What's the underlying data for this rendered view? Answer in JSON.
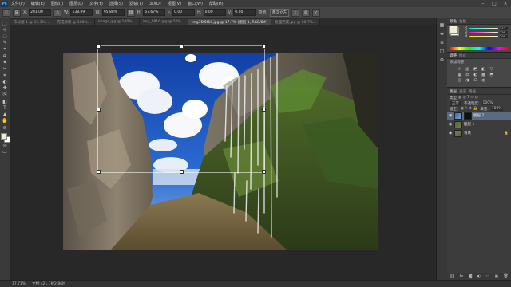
{
  "app": {
    "logo": "Ps",
    "menu": [
      "文件(F)",
      "编辑(E)",
      "图像(I)",
      "图层(L)",
      "文字(Y)",
      "选择(S)",
      "滤镜(T)",
      "3D(D)",
      "视图(V)",
      "窗口(W)",
      "帮助(H)"
    ],
    "window_controls": [
      "–",
      "□",
      "×"
    ]
  },
  "options": {
    "x_label": "X:",
    "x_value": "281.00",
    "w_label": "W:",
    "w_value": "138.09",
    "w_pct": "95.88%",
    "h_label": "H:",
    "h_value": "67.67%",
    "angle_label": "△",
    "angle_value": "0.00",
    "h_skew_label": "H:",
    "h_skew_value": "0.00",
    "v_skew_label": "V:",
    "v_skew_value": "0.00",
    "interp": "两次立方",
    "confirm": "✓",
    "cancel": "⊘"
  },
  "tabs": [
    {
      "label": "未标题-1 @ 33.3% ...",
      "active": false
    },
    {
      "label": "完成效果 @ 100%...",
      "active": false
    },
    {
      "label": "image.jpg @ 100%...",
      "active": false
    },
    {
      "label": "img_0916.jpg @ 50%...",
      "active": false
    },
    {
      "label": "img75f5f10.jpg @ 17.7% (图层 1, RGB/8#)",
      "active": true
    },
    {
      "label": "处理完成.jpg @ 66.7%...",
      "active": false
    }
  ],
  "tools": [
    "⬚",
    "⊹",
    "◌",
    "✎",
    "⌖",
    "⊕",
    "✦",
    "✂",
    "⌗",
    "◐",
    "✚",
    "⎘",
    "◧",
    "T",
    "▲",
    "✋",
    "⊚"
  ],
  "status": {
    "zoom": "17.71%",
    "doc_size": "文档:421.7K/2.86M"
  },
  "panel_strip": [
    "▦",
    "◈",
    "≡",
    "◫",
    "⚙"
  ],
  "color_panel": {
    "tabs": [
      "颜色",
      "色板"
    ],
    "fg_color": "#f2ecd1",
    "sliders": [
      {
        "letter": "R",
        "value": "242"
      },
      {
        "letter": "G",
        "value": "236"
      },
      {
        "letter": "B",
        "value": "209"
      }
    ]
  },
  "adjustments": {
    "tabs": [
      "调整",
      "样式"
    ],
    "subtitle": "添加调整",
    "icons": [
      "☼",
      "▥",
      "◩",
      "◧",
      "▽",
      "▦",
      "⚖",
      "◐",
      "▩",
      "◓",
      "▤",
      "◑",
      "⊟",
      "◍"
    ]
  },
  "layers": {
    "tabs": [
      "图层",
      "通道",
      "路径"
    ],
    "kind": "类型",
    "blend": "正常",
    "opacity_label": "不透明度:",
    "opacity": "100%",
    "lock_label": "锁定:",
    "fill_label": "填充:",
    "fill": "100%",
    "items": [
      {
        "name": "图层 2",
        "selected": true
      },
      {
        "name": "图层 1",
        "selected": false
      },
      {
        "name": "背景",
        "selected": false
      }
    ]
  }
}
